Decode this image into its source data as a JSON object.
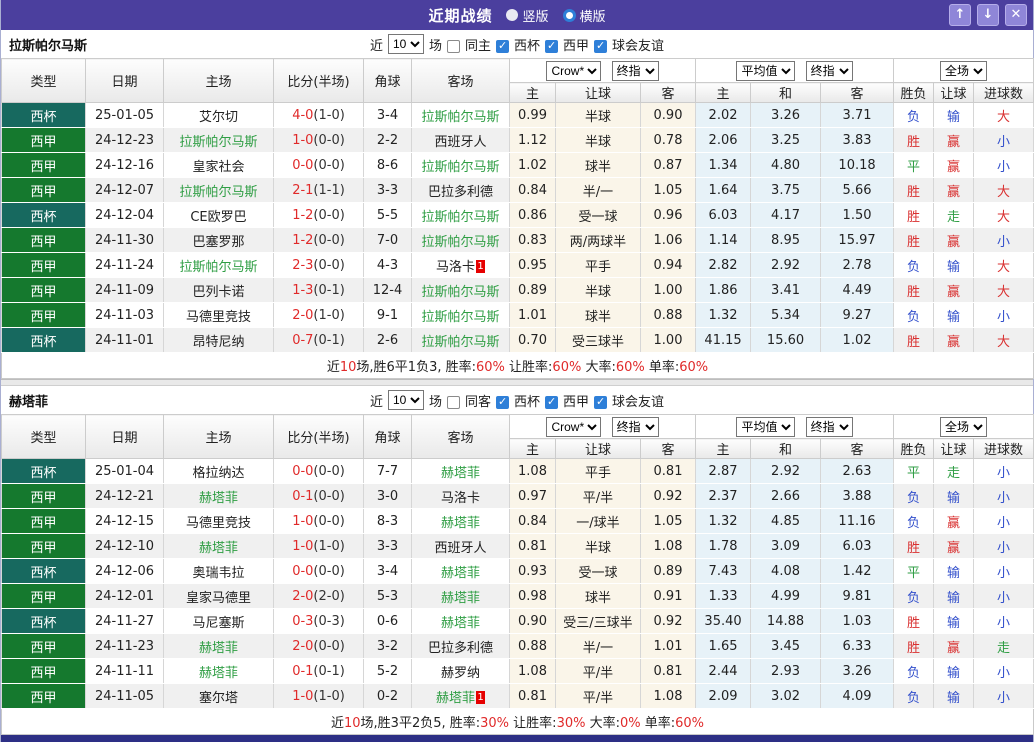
{
  "titlebar": {
    "title": "近期战绩",
    "radios": [
      {
        "label": "竖版",
        "selected": false
      },
      {
        "label": "横版",
        "selected": true
      }
    ],
    "buttons": {
      "up": "↑",
      "down": "↓",
      "close": "✕"
    }
  },
  "filter_labels": {
    "near": "近",
    "matches": "场",
    "leagues": [
      "西杯",
      "西甲",
      "球会友谊"
    ]
  },
  "header_selects": {
    "book": "Crow*",
    "book_stage": "终指",
    "avg": "平均值",
    "avg_stage": "终指",
    "scope": "全场"
  },
  "columns": {
    "main": [
      "类型",
      "日期",
      "主场",
      "比分(半场)",
      "角球",
      "客场"
    ],
    "sub": [
      "主",
      "让球",
      "客",
      "主",
      "和",
      "客",
      "胜负",
      "让球",
      "进球数"
    ]
  },
  "result_color_map": {
    "胜": "r",
    "平": "g",
    "负": "b",
    "赢": "r",
    "走": "g",
    "输": "b",
    "大": "r",
    "小": "b"
  },
  "colors": {
    "titlebar_bg": "#4b3f9e",
    "titlebar_button_bg": "#8f86d8",
    "cup_bg": "#17695f",
    "league_bg": "#15792e",
    "focal_team_green": "#2f9e44",
    "score_red": "#e02a2a",
    "result_red": "#d93030",
    "result_green": "#2f9e44",
    "result_blue": "#3350cc",
    "summary_red": "#e02a2a",
    "odds_tint_cream": "#faf5e9",
    "avg_tint_blue": "#e7f2f8",
    "row_stripe": "#f0f0f0",
    "checkbox_blue": "#2e7fd8",
    "bottom_bar": "#2d2f85"
  },
  "tables": [
    {
      "team": "拉斯帕尔马斯",
      "filter": {
        "count": "10",
        "same_label": "同主",
        "same_checked": false,
        "leagues_checked": [
          true,
          true,
          true
        ]
      },
      "rows": [
        {
          "type": "西杯",
          "tk": "cup",
          "date": "25-01-05",
          "home": "艾尔切",
          "away": "拉斯帕尔马斯",
          "focal": "away",
          "hb": "",
          "ab": "",
          "ft": "4-0",
          "ht": "(1-0)",
          "corner": "3-4",
          "crow": [
            "0.99",
            "半球",
            "0.90"
          ],
          "avg": [
            "2.02",
            "3.26",
            "3.71"
          ],
          "res": [
            "负",
            "输",
            "大"
          ]
        },
        {
          "type": "西甲",
          "tk": "league",
          "date": "24-12-23",
          "home": "拉斯帕尔马斯",
          "away": "西班牙人",
          "focal": "home",
          "hb": "",
          "ab": "",
          "ft": "1-0",
          "ht": "(0-0)",
          "corner": "2-2",
          "crow": [
            "1.12",
            "半球",
            "0.78"
          ],
          "avg": [
            "2.06",
            "3.25",
            "3.83"
          ],
          "res": [
            "胜",
            "赢",
            "小"
          ]
        },
        {
          "type": "西甲",
          "tk": "league",
          "date": "24-12-16",
          "home": "皇家社会",
          "away": "拉斯帕尔马斯",
          "focal": "away",
          "hb": "",
          "ab": "",
          "ft": "0-0",
          "ht": "(0-0)",
          "corner": "8-6",
          "crow": [
            "1.02",
            "球半",
            "0.87"
          ],
          "avg": [
            "1.34",
            "4.80",
            "10.18"
          ],
          "res": [
            "平",
            "赢",
            "小"
          ]
        },
        {
          "type": "西甲",
          "tk": "league",
          "date": "24-12-07",
          "home": "拉斯帕尔马斯",
          "away": "巴拉多利德",
          "focal": "home",
          "hb": "",
          "ab": "",
          "ft": "2-1",
          "ht": "(1-1)",
          "corner": "3-3",
          "crow": [
            "0.84",
            "半/一",
            "1.05"
          ],
          "avg": [
            "1.64",
            "3.75",
            "5.66"
          ],
          "res": [
            "胜",
            "赢",
            "大"
          ]
        },
        {
          "type": "西杯",
          "tk": "cup",
          "date": "24-12-04",
          "home": "CE欧罗巴",
          "away": "拉斯帕尔马斯",
          "focal": "away",
          "hb": "",
          "ab": "",
          "ft": "1-2",
          "ht": "(0-0)",
          "corner": "5-5",
          "crow": [
            "0.86",
            "受一球",
            "0.96"
          ],
          "avg": [
            "6.03",
            "4.17",
            "1.50"
          ],
          "res": [
            "胜",
            "走",
            "大"
          ]
        },
        {
          "type": "西甲",
          "tk": "league",
          "date": "24-11-30",
          "home": "巴塞罗那",
          "away": "拉斯帕尔马斯",
          "focal": "away",
          "hb": "",
          "ab": "",
          "ft": "1-2",
          "ht": "(0-0)",
          "corner": "7-0",
          "crow": [
            "0.83",
            "两/两球半",
            "1.06"
          ],
          "avg": [
            "1.14",
            "8.95",
            "15.97"
          ],
          "res": [
            "胜",
            "赢",
            "小"
          ]
        },
        {
          "type": "西甲",
          "tk": "league",
          "date": "24-11-24",
          "home": "拉斯帕尔马斯",
          "away": "马洛卡",
          "focal": "home",
          "hb": "",
          "ab": "1",
          "ft": "2-3",
          "ht": "(0-0)",
          "corner": "4-3",
          "crow": [
            "0.95",
            "平手",
            "0.94"
          ],
          "avg": [
            "2.82",
            "2.92",
            "2.78"
          ],
          "res": [
            "负",
            "输",
            "大"
          ]
        },
        {
          "type": "西甲",
          "tk": "league",
          "date": "24-11-09",
          "home": "巴列卡诺",
          "away": "拉斯帕尔马斯",
          "focal": "away",
          "hb": "",
          "ab": "",
          "ft": "1-3",
          "ht": "(0-1)",
          "corner": "12-4",
          "crow": [
            "0.89",
            "半球",
            "1.00"
          ],
          "avg": [
            "1.86",
            "3.41",
            "4.49"
          ],
          "res": [
            "胜",
            "赢",
            "大"
          ]
        },
        {
          "type": "西甲",
          "tk": "league",
          "date": "24-11-03",
          "home": "马德里竞技",
          "away": "拉斯帕尔马斯",
          "focal": "away",
          "hb": "",
          "ab": "",
          "ft": "2-0",
          "ht": "(1-0)",
          "corner": "9-1",
          "crow": [
            "1.01",
            "球半",
            "0.88"
          ],
          "avg": [
            "1.32",
            "5.34",
            "9.27"
          ],
          "res": [
            "负",
            "输",
            "小"
          ]
        },
        {
          "type": "西杯",
          "tk": "cup",
          "date": "24-11-01",
          "home": "昂特尼纳",
          "away": "拉斯帕尔马斯",
          "focal": "away",
          "hb": "",
          "ab": "",
          "ft": "0-7",
          "ht": "(0-1)",
          "corner": "2-6",
          "crow": [
            "0.70",
            "受三球半",
            "1.00"
          ],
          "avg": [
            "41.15",
            "15.60",
            "1.02"
          ],
          "res": [
            "胜",
            "赢",
            "大"
          ]
        }
      ],
      "summary": [
        {
          "t": "近",
          "r": false
        },
        {
          "t": "10",
          "r": true
        },
        {
          "t": "场,胜6平1负3, 胜率:",
          "r": false
        },
        {
          "t": "60%",
          "r": true
        },
        {
          "t": " 让胜率:",
          "r": false
        },
        {
          "t": "60%",
          "r": true
        },
        {
          "t": " 大率:",
          "r": false
        },
        {
          "t": "60%",
          "r": true
        },
        {
          "t": " 单率:",
          "r": false
        },
        {
          "t": "60%",
          "r": true
        }
      ]
    },
    {
      "team": "赫塔菲",
      "filter": {
        "count": "10",
        "same_label": "同客",
        "same_checked": false,
        "leagues_checked": [
          true,
          true,
          true
        ]
      },
      "rows": [
        {
          "type": "西杯",
          "tk": "cup",
          "date": "25-01-04",
          "home": "格拉纳达",
          "away": "赫塔菲",
          "focal": "away",
          "hb": "",
          "ab": "",
          "ft": "0-0",
          "ht": "(0-0)",
          "corner": "7-7",
          "crow": [
            "1.08",
            "平手",
            "0.81"
          ],
          "avg": [
            "2.87",
            "2.92",
            "2.63"
          ],
          "res": [
            "平",
            "走",
            "小"
          ]
        },
        {
          "type": "西甲",
          "tk": "league",
          "date": "24-12-21",
          "home": "赫塔菲",
          "away": "马洛卡",
          "focal": "home",
          "hb": "",
          "ab": "",
          "ft": "0-1",
          "ht": "(0-0)",
          "corner": "3-0",
          "crow": [
            "0.97",
            "平/半",
            "0.92"
          ],
          "avg": [
            "2.37",
            "2.66",
            "3.88"
          ],
          "res": [
            "负",
            "输",
            "小"
          ]
        },
        {
          "type": "西甲",
          "tk": "league",
          "date": "24-12-15",
          "home": "马德里竞技",
          "away": "赫塔菲",
          "focal": "away",
          "hb": "",
          "ab": "",
          "ft": "1-0",
          "ht": "(0-0)",
          "corner": "8-3",
          "crow": [
            "0.84",
            "一/球半",
            "1.05"
          ],
          "avg": [
            "1.32",
            "4.85",
            "11.16"
          ],
          "res": [
            "负",
            "赢",
            "小"
          ]
        },
        {
          "type": "西甲",
          "tk": "league",
          "date": "24-12-10",
          "home": "赫塔菲",
          "away": "西班牙人",
          "focal": "home",
          "hb": "",
          "ab": "",
          "ft": "1-0",
          "ht": "(1-0)",
          "corner": "3-3",
          "crow": [
            "0.81",
            "半球",
            "1.08"
          ],
          "avg": [
            "1.78",
            "3.09",
            "6.03"
          ],
          "res": [
            "胜",
            "赢",
            "小"
          ]
        },
        {
          "type": "西杯",
          "tk": "cup",
          "date": "24-12-06",
          "home": "奥瑞韦拉",
          "away": "赫塔菲",
          "focal": "away",
          "hb": "",
          "ab": "",
          "ft": "0-0",
          "ht": "(0-0)",
          "corner": "3-4",
          "crow": [
            "0.93",
            "受一球",
            "0.89"
          ],
          "avg": [
            "7.43",
            "4.08",
            "1.42"
          ],
          "res": [
            "平",
            "输",
            "小"
          ]
        },
        {
          "type": "西甲",
          "tk": "league",
          "date": "24-12-01",
          "home": "皇家马德里",
          "away": "赫塔菲",
          "focal": "away",
          "hb": "",
          "ab": "",
          "ft": "2-0",
          "ht": "(2-0)",
          "corner": "5-3",
          "crow": [
            "0.98",
            "球半",
            "0.91"
          ],
          "avg": [
            "1.33",
            "4.99",
            "9.81"
          ],
          "res": [
            "负",
            "输",
            "小"
          ]
        },
        {
          "type": "西杯",
          "tk": "cup",
          "date": "24-11-27",
          "home": "马尼塞斯",
          "away": "赫塔菲",
          "focal": "away",
          "hb": "",
          "ab": "",
          "ft": "0-3",
          "ht": "(0-3)",
          "corner": "0-6",
          "crow": [
            "0.90",
            "受三/三球半",
            "0.92"
          ],
          "avg": [
            "35.40",
            "14.88",
            "1.03"
          ],
          "res": [
            "胜",
            "输",
            "小"
          ]
        },
        {
          "type": "西甲",
          "tk": "league",
          "date": "24-11-23",
          "home": "赫塔菲",
          "away": "巴拉多利德",
          "focal": "home",
          "hb": "",
          "ab": "",
          "ft": "2-0",
          "ht": "(0-0)",
          "corner": "3-2",
          "crow": [
            "0.88",
            "半/一",
            "1.01"
          ],
          "avg": [
            "1.65",
            "3.45",
            "6.33"
          ],
          "res": [
            "胜",
            "赢",
            "走"
          ]
        },
        {
          "type": "西甲",
          "tk": "league",
          "date": "24-11-11",
          "home": "赫塔菲",
          "away": "赫罗纳",
          "focal": "home",
          "hb": "",
          "ab": "",
          "ft": "0-1",
          "ht": "(0-1)",
          "corner": "5-2",
          "crow": [
            "1.08",
            "平/半",
            "0.81"
          ],
          "avg": [
            "2.44",
            "2.93",
            "3.26"
          ],
          "res": [
            "负",
            "输",
            "小"
          ]
        },
        {
          "type": "西甲",
          "tk": "league",
          "date": "24-11-05",
          "home": "塞尔塔",
          "away": "赫塔菲",
          "focal": "away",
          "hb": "",
          "ab": "1",
          "ft": "1-0",
          "ht": "(1-0)",
          "corner": "0-2",
          "crow": [
            "0.81",
            "平/半",
            "1.08"
          ],
          "avg": [
            "2.09",
            "3.02",
            "4.09"
          ],
          "res": [
            "负",
            "输",
            "小"
          ]
        }
      ],
      "summary": [
        {
          "t": "近",
          "r": false
        },
        {
          "t": "10",
          "r": true
        },
        {
          "t": "场,胜3平2负5, 胜率:",
          "r": false
        },
        {
          "t": "30%",
          "r": true
        },
        {
          "t": " 让胜率:",
          "r": false
        },
        {
          "t": "30%",
          "r": true
        },
        {
          "t": " 大率:",
          "r": false
        },
        {
          "t": "0%",
          "r": true
        },
        {
          "t": " 单率:",
          "r": false
        },
        {
          "t": "60%",
          "r": true
        }
      ]
    }
  ]
}
